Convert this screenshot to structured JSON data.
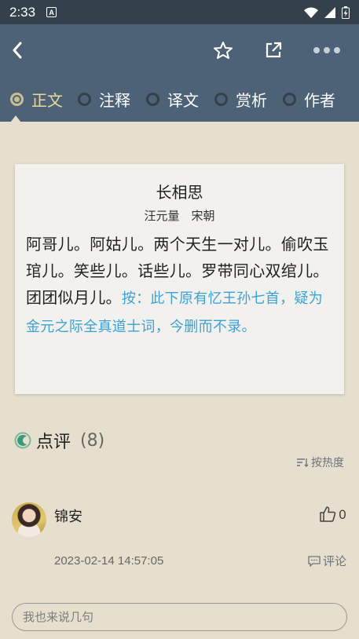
{
  "status_bar": {
    "time": "2:33",
    "badge": "A"
  },
  "header": {
    "tabs": [
      {
        "label": "正文",
        "active": true
      },
      {
        "label": "注释",
        "active": false
      },
      {
        "label": "译文",
        "active": false
      },
      {
        "label": "赏析",
        "active": false
      },
      {
        "label": "作者",
        "active": false
      }
    ]
  },
  "poem": {
    "title": "长相思",
    "author": "汪元量　宋朝",
    "body": "阿哥儿。阿姑儿。两个天生一对儿。偷吹玉琯儿。笑些儿。话些儿。罗带同心双绾儿。团团似月儿。",
    "note": "按：此下原有忆王孙七首，疑为金元之际全真道士词，今删而不录。"
  },
  "comments": {
    "title": "点评",
    "count": "(8)",
    "sort_label": "按热度",
    "items": [
      {
        "user": "锦安",
        "likes": "0",
        "time": "2023-02-14 14:57:05",
        "reply_label": "评论"
      }
    ]
  },
  "input": {
    "placeholder": "我也来说几句"
  },
  "colors": {
    "header_bg": "#4d6276",
    "status_bg": "#34404b",
    "page_bg": "#e6dfcd",
    "note": "#3ba2d6",
    "active_tab": "#e8d9a0"
  }
}
